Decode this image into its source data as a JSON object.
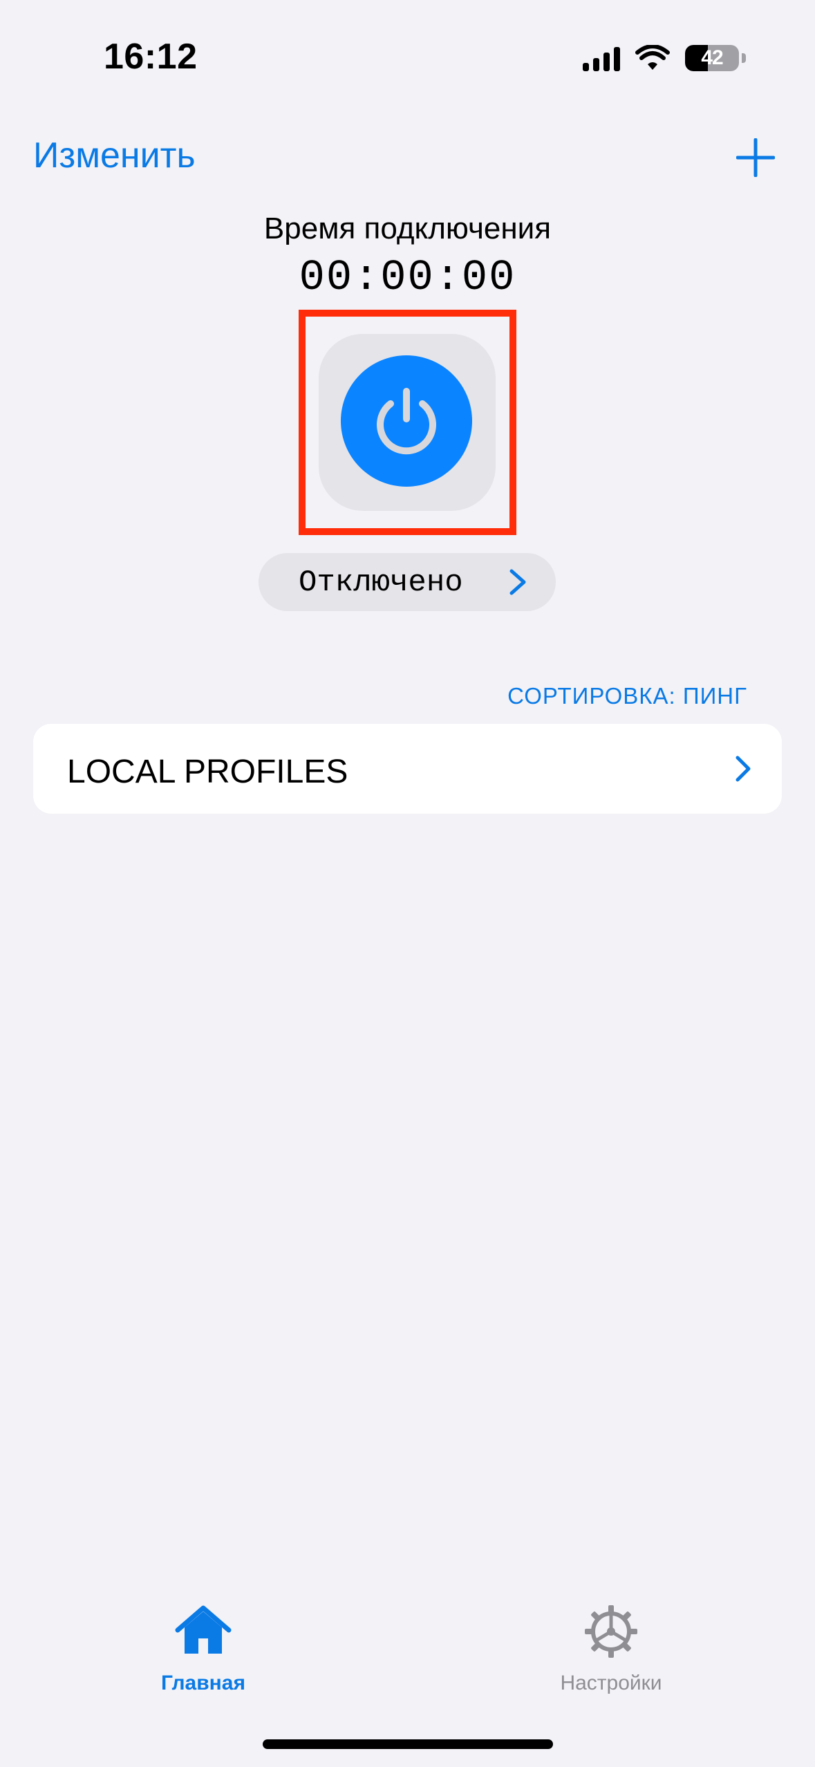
{
  "status_bar": {
    "time": "16:12",
    "battery_level": "42"
  },
  "nav": {
    "edit_label": "Изменить",
    "add_icon": "plus-icon"
  },
  "connection": {
    "time_label": "Время подключения",
    "timer": "00:00:00",
    "power_icon": "power-icon",
    "status": "Отключено"
  },
  "sort": {
    "label": "СОРТИРОВКА: ПИНГ"
  },
  "profiles": {
    "group_label": "LOCAL PROFILES"
  },
  "tab_bar": {
    "items": [
      {
        "label": "Главная",
        "icon": "home-icon",
        "active": true
      },
      {
        "label": "Настройки",
        "icon": "gear-icon",
        "active": false
      }
    ]
  },
  "colors": {
    "accent": "#0A84FF",
    "link": "#0A7AE5",
    "background": "#F2F2F7",
    "highlight": "#FF2D0A"
  }
}
